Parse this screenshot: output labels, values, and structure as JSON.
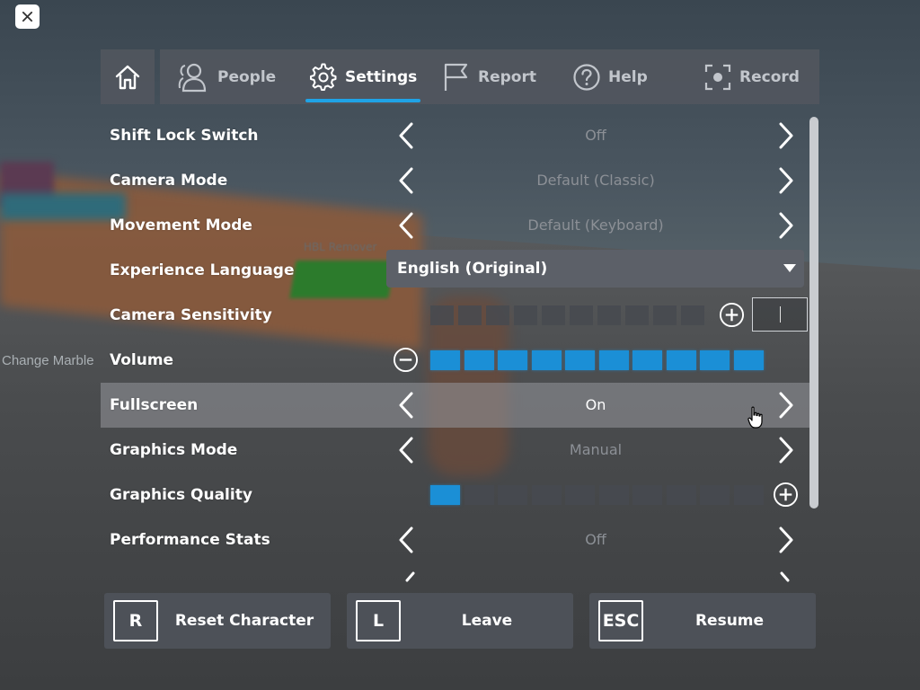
{
  "world": {
    "sign_text": "HBL Remover",
    "side_label": "Change Marble"
  },
  "close_button": {
    "icon": "close-icon"
  },
  "tabs": {
    "home": {
      "icon": "home-icon"
    },
    "items": [
      {
        "label": "People",
        "icon": "people-icon",
        "active": false
      },
      {
        "label": "Settings",
        "icon": "gear-icon",
        "active": true
      },
      {
        "label": "Report",
        "icon": "flag-icon",
        "active": false
      },
      {
        "label": "Help",
        "icon": "help-icon",
        "active": false
      },
      {
        "label": "Record",
        "icon": "record-icon",
        "active": false
      }
    ]
  },
  "settings": {
    "shift_lock": {
      "label": "Shift Lock Switch",
      "value": "Off"
    },
    "camera_mode": {
      "label": "Camera Mode",
      "value": "Default (Classic)"
    },
    "movement_mode": {
      "label": "Movement Mode",
      "value": "Default (Keyboard)"
    },
    "language": {
      "label": "Experience Language",
      "value": "English (Original)"
    },
    "camera_sensitivity": {
      "label": "Camera Sensitivity",
      "filled": 0,
      "segments": 10,
      "input_value": ""
    },
    "volume": {
      "label": "Volume",
      "filled": 10,
      "segments": 10
    },
    "fullscreen": {
      "label": "Fullscreen",
      "value": "On"
    },
    "graphics_mode": {
      "label": "Graphics Mode",
      "value": "Manual"
    },
    "graphics_quality": {
      "label": "Graphics Quality",
      "filled": 1,
      "segments": 10
    },
    "performance_stats": {
      "label": "Performance Stats",
      "value": "Off"
    }
  },
  "actions": {
    "reset": {
      "key": "R",
      "label": "Reset Character"
    },
    "leave": {
      "key": "L",
      "label": "Leave"
    },
    "resume": {
      "key": "ESC",
      "label": "Resume"
    }
  },
  "colors": {
    "accent": "#1fa3e6",
    "slider_on": "#1b8fd6",
    "panel": "#52565e",
    "value_text": "#8c9096"
  }
}
